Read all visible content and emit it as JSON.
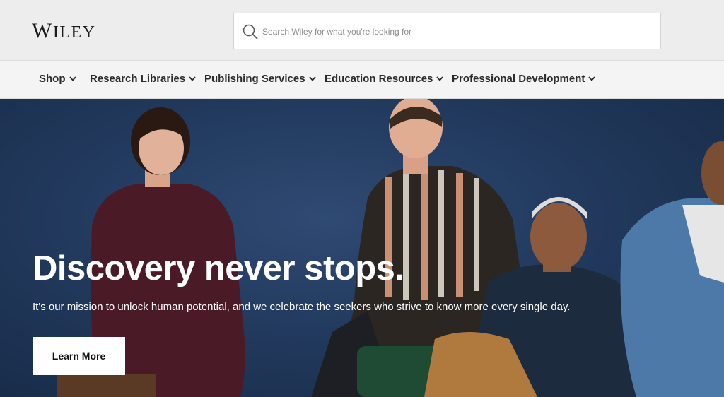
{
  "header": {
    "logo_text": "Wiley",
    "search": {
      "placeholder": "Search Wiley for what you're looking for",
      "icon": "search-icon"
    }
  },
  "nav": {
    "items": [
      {
        "label": "Shop"
      },
      {
        "label": "Research Libraries"
      },
      {
        "label": "Publishing Services"
      },
      {
        "label": "Education Resources"
      },
      {
        "label": "Professional Development"
      }
    ]
  },
  "hero": {
    "headline": "Discovery never stops.",
    "subtext": "It's our mission to unlock human potential, and we celebrate the seekers who strive to know more every single day.",
    "cta_label": "Learn More"
  },
  "colors": {
    "hero_background": "#223a5e",
    "header_background": "#ededed",
    "nav_background": "#f4f4f4",
    "text_dark": "#2b2b2b"
  }
}
